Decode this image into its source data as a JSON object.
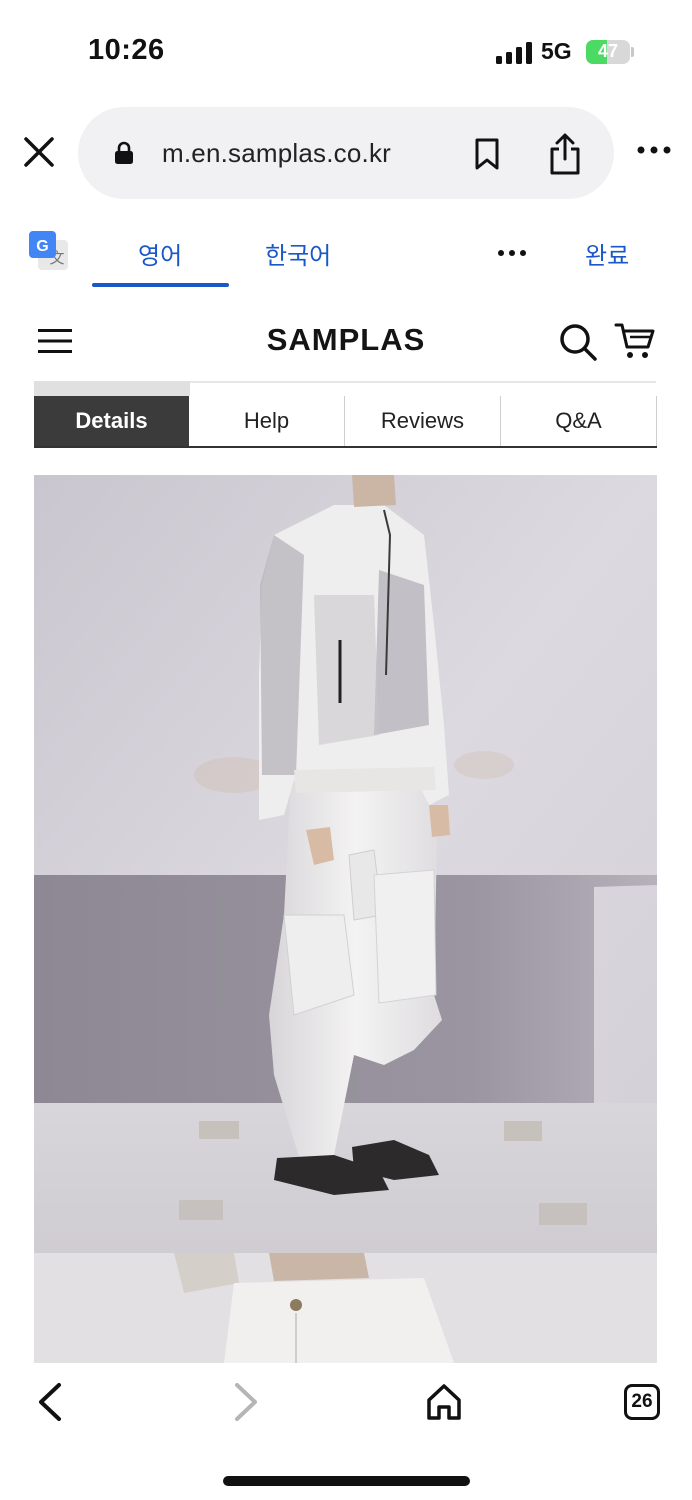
{
  "status_bar": {
    "time": "10:26",
    "network": "5G",
    "battery_percent": "47",
    "battery_level": 0.47
  },
  "browser": {
    "url": "m.en.samplas.co.kr",
    "icons": [
      "close-icon",
      "lock-icon",
      "bookmark-icon",
      "share-icon",
      "more-icon"
    ]
  },
  "translate_bar": {
    "source_language": "영어",
    "target_language": "한국어",
    "done_label": "완료",
    "active_tab": "source",
    "accent_color": "#1a57c9"
  },
  "site": {
    "logo": "SAMPLAS",
    "icons": [
      "menu-icon",
      "search-icon",
      "cart-icon"
    ]
  },
  "product_tabs": [
    {
      "label": "Details",
      "active": true
    },
    {
      "label": "Help",
      "active": false
    },
    {
      "label": "Reviews",
      "active": false
    },
    {
      "label": "Q&A",
      "active": false
    }
  ],
  "toolbar": {
    "tab_count": "26",
    "icons": [
      "back-icon",
      "forward-icon",
      "home-icon",
      "tabs-icon"
    ]
  }
}
